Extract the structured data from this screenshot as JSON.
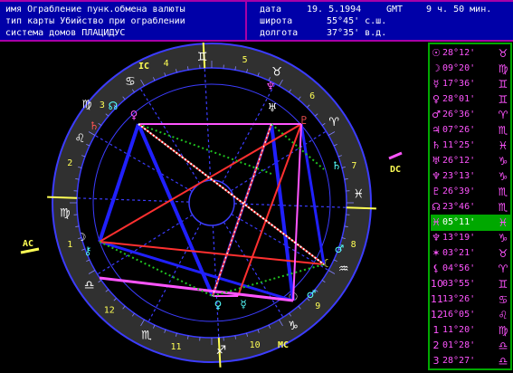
{
  "header": {
    "line1_left": "имя Ограбление пунк.обмена валюты",
    "line2_left": "тип карты Убийство при ограблении",
    "line3_left": "система домов ПЛАЦИДУС",
    "date_label": "дата",
    "date_value": "19. 5.1994",
    "tz": "GMT",
    "time_value": "9 ч. 50 мин.",
    "lat_label": "широта",
    "lat_value": "55°45' с.ш.",
    "lon_label": "долгота",
    "lon_value": "37°35' в.д."
  },
  "angles": {
    "ac_label": "AC",
    "dc_label": "DC",
    "ic_label": "IC",
    "mc_label": "MC"
  },
  "house_numbers": [
    "1",
    "2",
    "3",
    "4",
    "5",
    "6",
    "7",
    "8",
    "9",
    "10",
    "11",
    "12"
  ],
  "positions": [
    {
      "glyph": "☉",
      "deg": "28°12'",
      "sign": "♉",
      "highlight": false
    },
    {
      "glyph": "☽",
      "deg": "09°20'",
      "sign": "♍",
      "highlight": false
    },
    {
      "glyph": "☿",
      "deg": "17°36'",
      "sign": "♊",
      "highlight": false
    },
    {
      "glyph": "♀",
      "deg": "28°01'",
      "sign": "♊",
      "highlight": false
    },
    {
      "glyph": "♂",
      "deg": "26°36'",
      "sign": "♈",
      "highlight": false
    },
    {
      "glyph": "♃",
      "deg": "07°26'",
      "sign": "♏",
      "highlight": false
    },
    {
      "glyph": "♄",
      "deg": "11°25'",
      "sign": "♓",
      "highlight": false
    },
    {
      "glyph": "♅",
      "deg": "26°12'",
      "sign": "♑",
      "highlight": false
    },
    {
      "glyph": "♆",
      "deg": "23°13'",
      "sign": "♑",
      "highlight": false
    },
    {
      "glyph": "♇",
      "deg": "26°39'",
      "sign": "♏",
      "highlight": false
    },
    {
      "glyph": "☊",
      "deg": "23°46'",
      "sign": "♏",
      "highlight": false
    },
    {
      "glyph": "♓",
      "deg": "05°11'",
      "sign": "♓",
      "highlight": true
    },
    {
      "glyph": "♆",
      "deg": "13°19'",
      "sign": "♑",
      "highlight": false
    },
    {
      "glyph": "✶",
      "deg": "03°21'",
      "sign": "♉",
      "highlight": false
    },
    {
      "glyph": "⚸",
      "deg": "04°56'",
      "sign": "♈",
      "highlight": false
    },
    {
      "glyph": "10",
      "deg": "03°55'",
      "sign": "♊",
      "highlight": false
    },
    {
      "glyph": "11",
      "deg": "13°26'",
      "sign": "♋",
      "highlight": false
    },
    {
      "glyph": "12",
      "deg": "16°05'",
      "sign": "♌",
      "highlight": false
    },
    {
      "glyph": "1",
      "deg": "11°20'",
      "sign": "♍",
      "highlight": false
    },
    {
      "glyph": "2",
      "deg": "01°28'",
      "sign": "♎",
      "highlight": false
    },
    {
      "glyph": "3",
      "deg": "28°27'",
      "sign": "♎",
      "highlight": false
    }
  ],
  "colors": {
    "header_bg": "#0000a8",
    "frame": "#a800a8",
    "list_text": "#ff55ff",
    "list_border": "#00a800",
    "wheel_outline": "#3c3cff",
    "zodiac_band": "#303030",
    "glyph_cyan": "#55ffff",
    "glyph_white": "#ffffff",
    "glyph_magenta": "#ff55ff",
    "glyph_red": "#ff5555",
    "glyph_yellow": "#ffff55",
    "house_number_yellow": "#ffff55",
    "angle_label_yellow": "#ffff55",
    "aspect_blue": "#2020ff",
    "aspect_red": "#ff3030",
    "aspect_green": "#20c020",
    "aspect_pink": "#ff55ff",
    "aspect_white": "#ffffff"
  }
}
